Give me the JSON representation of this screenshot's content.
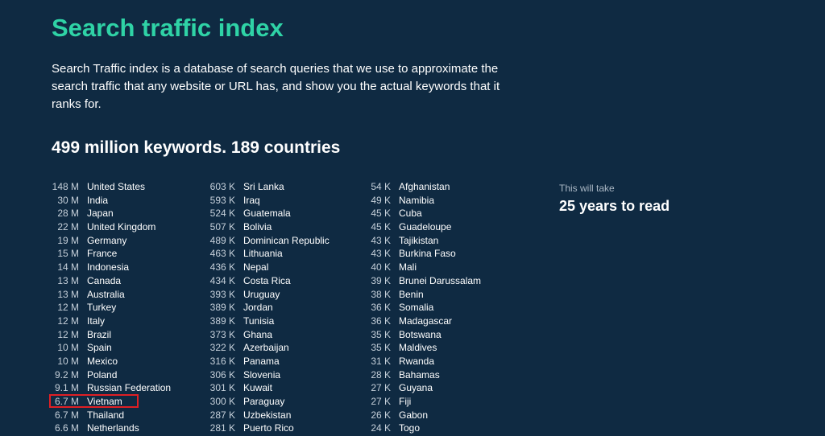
{
  "header": {
    "title": "Search traffic index",
    "description": "Search Traffic index is a database of search queries that we use to approximate the search traffic that any website or URL has, and show you the actual keywords that it ranks for.",
    "subtitle": "499 million keywords. 189 countries"
  },
  "sidebar_note": {
    "label": "This will take",
    "value": "25 years to read"
  },
  "highlighted_country": "Vietnam",
  "highlight_color": "#e01f24",
  "accent_color": "#2fd3a6",
  "background_color": "#0f2a42",
  "countries": {
    "column_1": [
      {
        "count": "148 M",
        "name": "United States"
      },
      {
        "count": "30 M",
        "name": "India"
      },
      {
        "count": "28 M",
        "name": "Japan"
      },
      {
        "count": "22 M",
        "name": "United Kingdom"
      },
      {
        "count": "19 M",
        "name": "Germany"
      },
      {
        "count": "15 M",
        "name": "France"
      },
      {
        "count": "14 M",
        "name": "Indonesia"
      },
      {
        "count": "13 M",
        "name": "Canada"
      },
      {
        "count": "13 M",
        "name": "Australia"
      },
      {
        "count": "12 M",
        "name": "Turkey"
      },
      {
        "count": "12 M",
        "name": "Italy"
      },
      {
        "count": "12 M",
        "name": "Brazil"
      },
      {
        "count": "10 M",
        "name": "Spain"
      },
      {
        "count": "10 M",
        "name": "Mexico"
      },
      {
        "count": "9.2 M",
        "name": "Poland"
      },
      {
        "count": "9.1 M",
        "name": "Russian Federation"
      },
      {
        "count": "6.7 M",
        "name": "Vietnam"
      },
      {
        "count": "6.7 M",
        "name": "Thailand"
      },
      {
        "count": "6.6 M",
        "name": "Netherlands"
      }
    ],
    "column_2": [
      {
        "count": "603 K",
        "name": "Sri Lanka"
      },
      {
        "count": "593 K",
        "name": "Iraq"
      },
      {
        "count": "524 K",
        "name": "Guatemala"
      },
      {
        "count": "507 K",
        "name": "Bolivia"
      },
      {
        "count": "489 K",
        "name": "Dominican Republic"
      },
      {
        "count": "463 K",
        "name": "Lithuania"
      },
      {
        "count": "436 K",
        "name": "Nepal"
      },
      {
        "count": "434 K",
        "name": "Costa Rica"
      },
      {
        "count": "393 K",
        "name": "Uruguay"
      },
      {
        "count": "389 K",
        "name": "Jordan"
      },
      {
        "count": "389 K",
        "name": "Tunisia"
      },
      {
        "count": "373 K",
        "name": "Ghana"
      },
      {
        "count": "322 K",
        "name": "Azerbaijan"
      },
      {
        "count": "316 K",
        "name": "Panama"
      },
      {
        "count": "306 K",
        "name": "Slovenia"
      },
      {
        "count": "301 K",
        "name": "Kuwait"
      },
      {
        "count": "300 K",
        "name": "Paraguay"
      },
      {
        "count": "287 K",
        "name": "Uzbekistan"
      },
      {
        "count": "281 K",
        "name": "Puerto Rico"
      }
    ],
    "column_3": [
      {
        "count": "54 K",
        "name": "Afghanistan"
      },
      {
        "count": "49 K",
        "name": "Namibia"
      },
      {
        "count": "45 K",
        "name": "Cuba"
      },
      {
        "count": "45 K",
        "name": "Guadeloupe"
      },
      {
        "count": "43 K",
        "name": "Tajikistan"
      },
      {
        "count": "43 K",
        "name": "Burkina Faso"
      },
      {
        "count": "40 K",
        "name": "Mali"
      },
      {
        "count": "39 K",
        "name": "Brunei Darussalam"
      },
      {
        "count": "38 K",
        "name": "Benin"
      },
      {
        "count": "36 K",
        "name": "Somalia"
      },
      {
        "count": "36 K",
        "name": "Madagascar"
      },
      {
        "count": "35 K",
        "name": "Botswana"
      },
      {
        "count": "35 K",
        "name": "Maldives"
      },
      {
        "count": "31 K",
        "name": "Rwanda"
      },
      {
        "count": "28 K",
        "name": "Bahamas"
      },
      {
        "count": "27 K",
        "name": "Guyana"
      },
      {
        "count": "27 K",
        "name": "Fiji"
      },
      {
        "count": "26 K",
        "name": "Gabon"
      },
      {
        "count": "24 K",
        "name": "Togo"
      }
    ]
  }
}
